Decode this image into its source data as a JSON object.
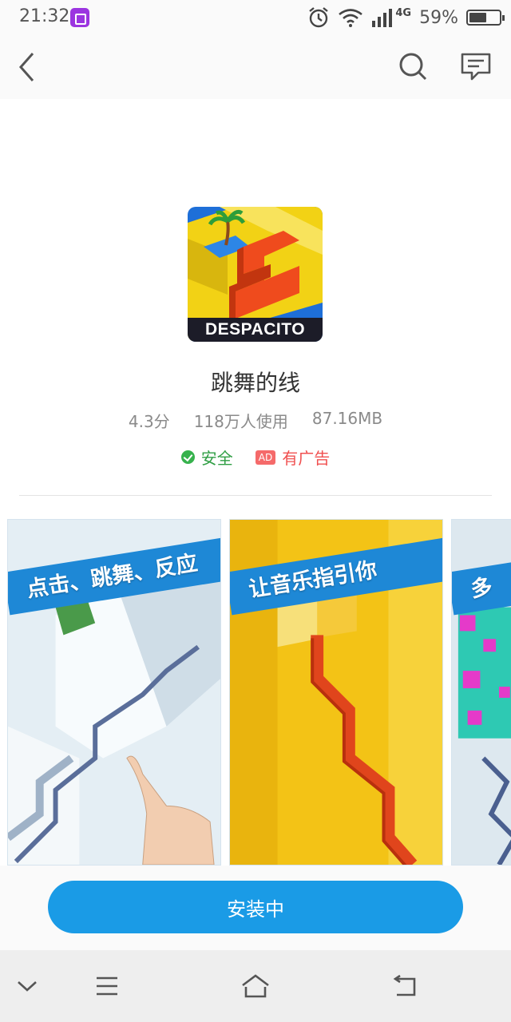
{
  "status_bar": {
    "time": "21:32",
    "network": "4G",
    "battery_percent_label": "59%",
    "battery_level": 0.59,
    "icons": [
      "screen-record-icon",
      "alarm-icon",
      "wifi-icon",
      "signal-icon",
      "battery-icon"
    ]
  },
  "top_nav": {
    "icons": [
      "back-arrow-icon",
      "search-icon",
      "comment-icon"
    ]
  },
  "app": {
    "icon_caption": "DESPACITO",
    "name": "跳舞的线",
    "rating": "4.3分",
    "users": "118万人使用",
    "size": "87.16MB",
    "safe_label": "安全",
    "ad_chip": "AD",
    "ad_label": "有广告"
  },
  "screenshots": [
    {
      "caption": "点击、跳舞、反应"
    },
    {
      "caption": "让音乐指引你"
    },
    {
      "caption": "多"
    }
  ],
  "install": {
    "label": "安装中"
  },
  "bottom_nav": {
    "icons": [
      "collapse-icon",
      "menu-icon",
      "home-icon",
      "back-icon"
    ]
  },
  "colors": {
    "accent": "#1a9be6",
    "safe": "#2f9e44",
    "ad": "#f05050"
  }
}
